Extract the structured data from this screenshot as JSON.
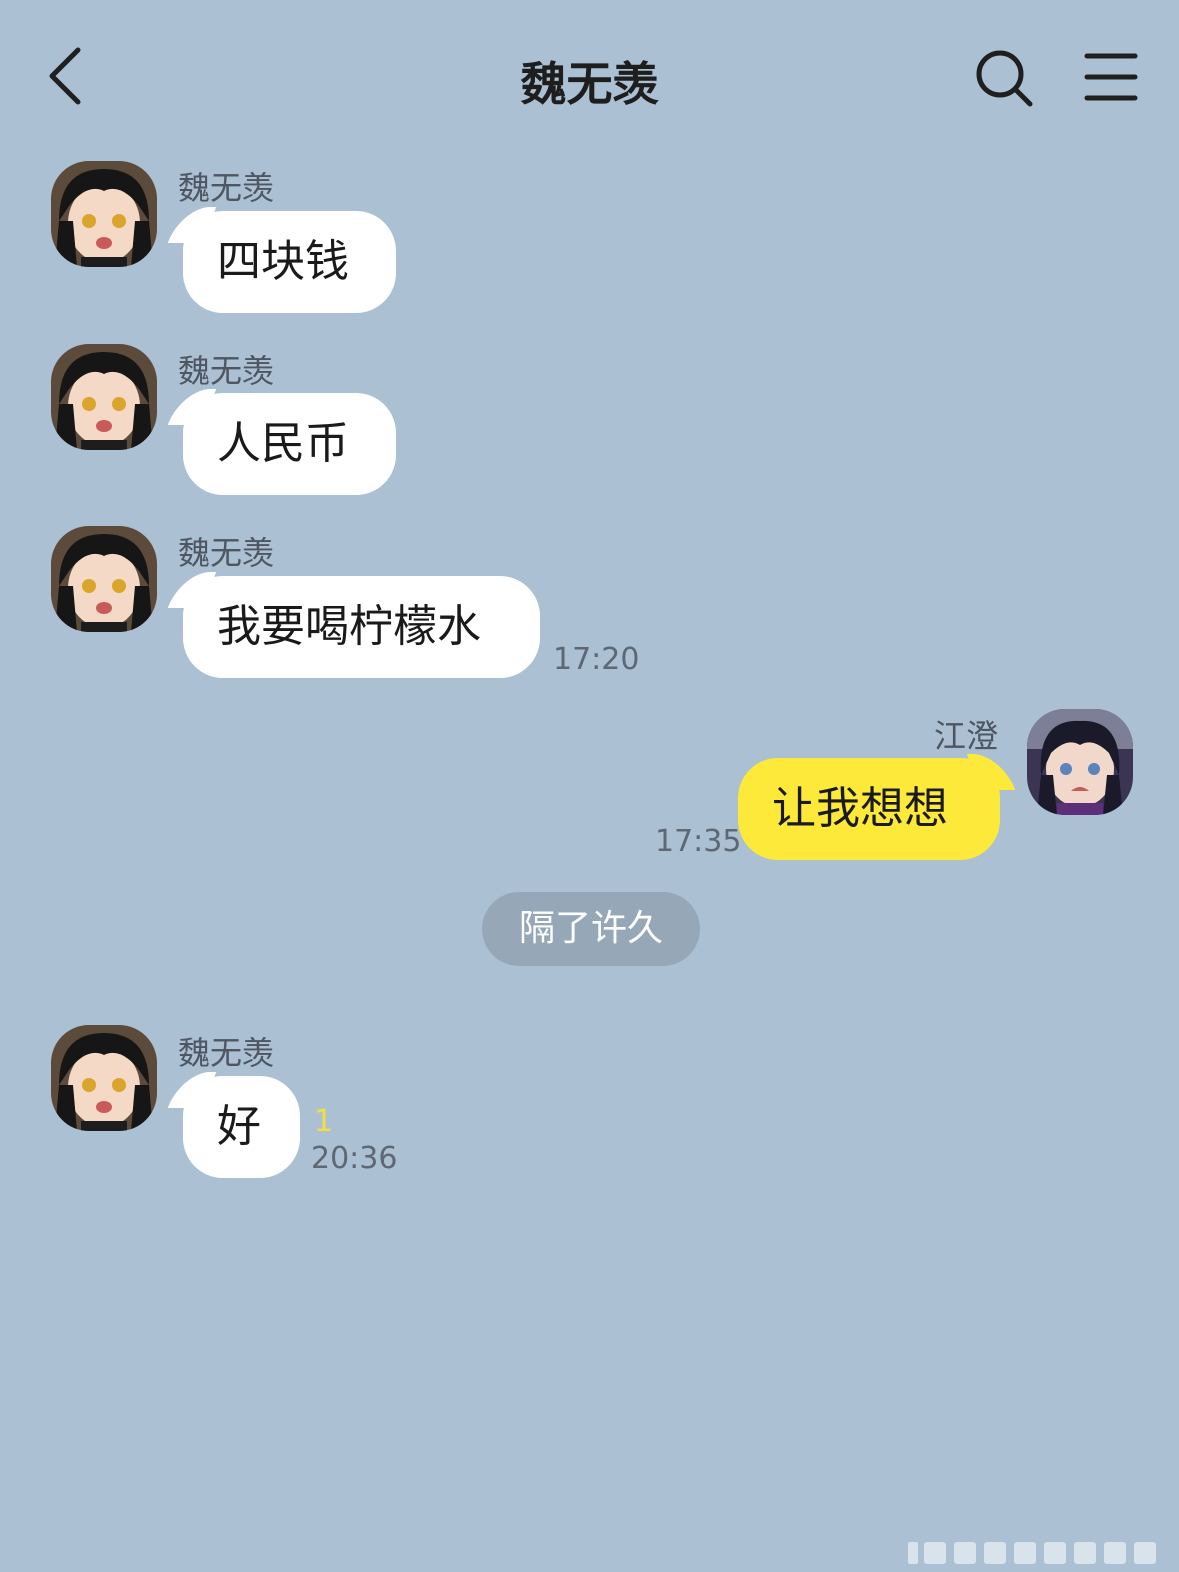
{
  "header": {
    "title": "魏无羡",
    "back_icon": "chevron-left-icon",
    "search_icon": "search-icon",
    "menu_icon": "menu-icon"
  },
  "messages": [
    {
      "sender": "魏无羡",
      "text": "四块钱"
    },
    {
      "sender": "魏无羡",
      "text": "人民币"
    },
    {
      "sender": "魏无羡",
      "text": "我要喝柠檬水",
      "time": "17:20"
    },
    {
      "sender": "江澄",
      "text": "让我想想",
      "time": "17:35"
    },
    {
      "sender": "魏无羡",
      "text": "好",
      "time": "20:36",
      "unread": "1"
    }
  ],
  "divider": "隔了许久",
  "colors": {
    "background": "#abc1d3",
    "incoming_bubble": "#ffffff",
    "outgoing_bubble": "#fde939",
    "unread": "#f2e040",
    "divider_pill": "#96a8b7"
  }
}
